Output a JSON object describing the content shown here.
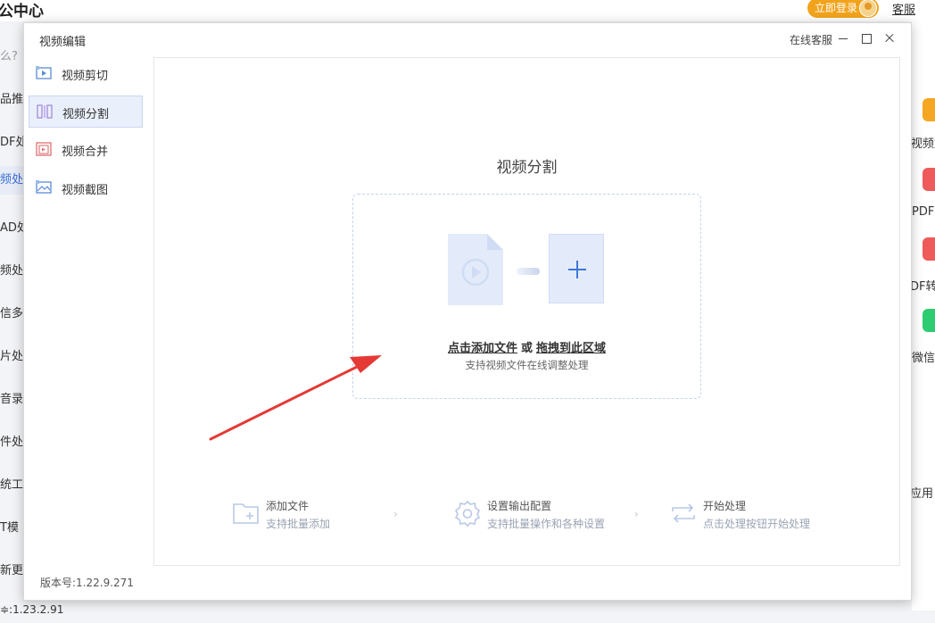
{
  "background": {
    "app_title": "公中心",
    "login_button": "立即登录",
    "service_link": "客服",
    "left_items": [
      "么?",
      "品推",
      "DF处",
      "频处",
      "AD处",
      "频处",
      "信多",
      "片处",
      "音录",
      "件处",
      "统工",
      "T模",
      "新更"
    ],
    "right_items": [
      "视频加",
      "PDF",
      "DF转",
      "微信",
      "应用"
    ],
    "bottom_version": "≑:1.23.2.91"
  },
  "modal": {
    "title": "视频编辑",
    "online_service": "在线客服",
    "sidebar": [
      {
        "label": "视频剪切",
        "icon": "video-cut-icon"
      },
      {
        "label": "视频分割",
        "icon": "video-split-icon"
      },
      {
        "label": "视频合并",
        "icon": "video-merge-icon"
      },
      {
        "label": "视频截图",
        "icon": "video-screenshot-icon"
      }
    ],
    "content_title": "视频分割",
    "drop": {
      "add_link": "点击添加文件",
      "or": "或",
      "drag_link": "拖拽到此区域",
      "subtitle": "支持视频文件在线调整处理"
    },
    "steps": [
      {
        "title": "添加文件",
        "desc": "支持批量添加",
        "icon": "add-folder-icon"
      },
      {
        "title": "设置输出配置",
        "desc": "支持批量操作和各种设置",
        "icon": "settings-gear-icon"
      },
      {
        "title": "开始处理",
        "desc": "点击处理按钮开始处理",
        "icon": "process-cycle-icon"
      }
    ],
    "version": "版本号:1.22.9.271"
  },
  "colors": {
    "accent": "#3d78d8",
    "login": "#f2a31c",
    "arrow": "#e53935"
  }
}
